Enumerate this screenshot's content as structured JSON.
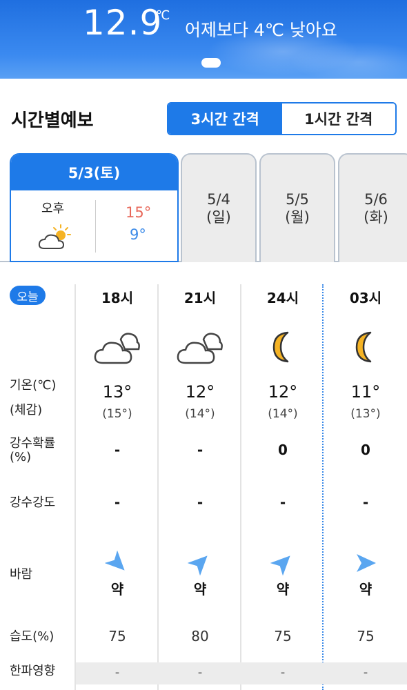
{
  "header": {
    "current_temp": "12.9",
    "temp_unit": "℃",
    "compare_text": "어제보다 4℃ 낮아요"
  },
  "section": {
    "title": "시간별예보",
    "toggle": {
      "option_3h": "3시간 간격",
      "option_1h": "1시간 간격",
      "selected": "3시간 간격"
    }
  },
  "days": [
    {
      "date": "5/3(토)",
      "period": "오후",
      "icon": "partly-cloudy-sun-icon",
      "high": "15°",
      "low": "9°",
      "selected": true
    },
    {
      "date_line1": "5/4",
      "date_line2": "(일)"
    },
    {
      "date_line1": "5/5",
      "date_line2": "(월)"
    },
    {
      "date_line1": "5/6",
      "date_line2": "(화)"
    }
  ],
  "today_badge": "오늘",
  "row_labels": {
    "temp": "기온(℃)",
    "feel": "(체감)",
    "precip_prob": "강수확률",
    "precip_prob_unit": "(%)",
    "precip_amount": "강수강도",
    "wind": "바람",
    "humidity": "습도(%)",
    "cold_wave": "한파영향"
  },
  "forecast": [
    {
      "hour": "18시",
      "icon": "cloudy-icon",
      "temp": "13°",
      "feel": "(15°)",
      "precip_prob": "-",
      "precip_amount": "-",
      "wind": "약",
      "wind_dir_deg": 135,
      "humidity": "75",
      "cold_wave": "-"
    },
    {
      "hour": "21시",
      "icon": "cloudy-icon",
      "temp": "12°",
      "feel": "(14°)",
      "precip_prob": "-",
      "precip_amount": "-",
      "wind": "약",
      "wind_dir_deg": 45,
      "humidity": "80",
      "cold_wave": "-"
    },
    {
      "hour": "24시",
      "icon": "moon-icon",
      "temp": "12°",
      "feel": "(14°)",
      "precip_prob": "0",
      "precip_amount": "-",
      "wind": "약",
      "wind_dir_deg": 45,
      "humidity": "75",
      "cold_wave": "-"
    },
    {
      "hour": "03시",
      "icon": "moon-icon",
      "temp": "11°",
      "feel": "(13°)",
      "precip_prob": "0",
      "precip_amount": "-",
      "wind": "약",
      "wind_dir_deg": 90,
      "humidity": "75",
      "cold_wave": "-"
    }
  ],
  "colors": {
    "accent": "#1e7ae8",
    "high_temp": "#e8685a",
    "low_temp": "#3b8ae8",
    "wind_arrow": "#5aa6f0",
    "moon": "#f5b324"
  }
}
